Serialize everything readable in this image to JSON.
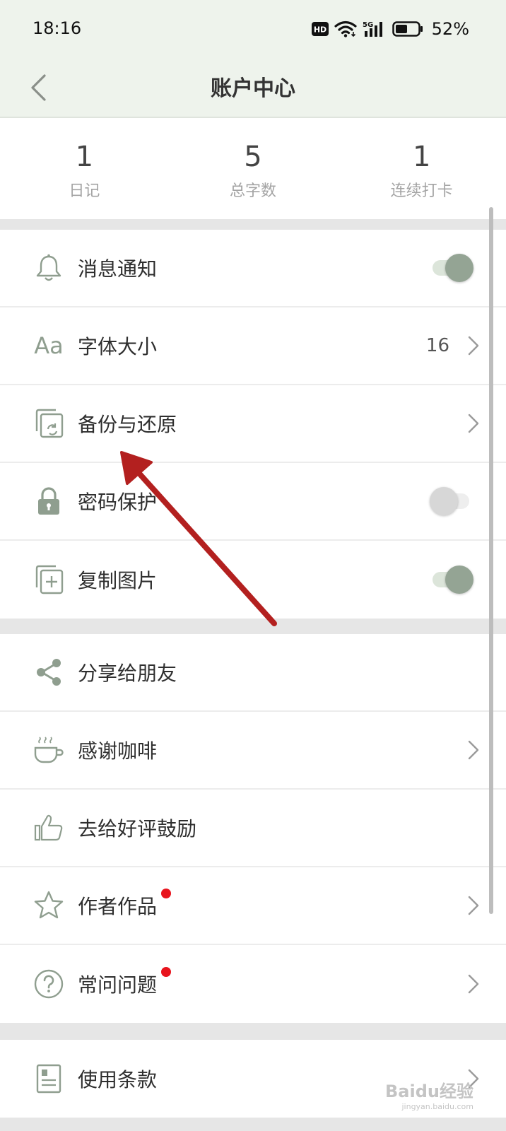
{
  "status_bar": {
    "time": "18:16",
    "hd_label": "HD",
    "network_label": "5G",
    "battery_percent": "52%",
    "battery_level": 0.52
  },
  "nav": {
    "title": "账户中心",
    "back_icon": "chevron-left-icon"
  },
  "stats": [
    {
      "value": "1",
      "label": "日记"
    },
    {
      "value": "5",
      "label": "总字数"
    },
    {
      "value": "1",
      "label": "连续打卡"
    }
  ],
  "settings": {
    "notification": {
      "label": "消息通知",
      "icon": "bell-icon",
      "toggle_on": true
    },
    "font_size": {
      "label": "字体大小",
      "icon": "font-size-icon",
      "icon_text": "Aa",
      "value": "16"
    },
    "backup": {
      "label": "备份与还原",
      "icon": "backup-restore-icon"
    },
    "password": {
      "label": "密码保护",
      "icon": "lock-icon",
      "toggle_on": false
    },
    "copy_image": {
      "label": "复制图片",
      "icon": "copy-add-icon",
      "toggle_on": true
    }
  },
  "social": {
    "share": {
      "label": "分享给朋友",
      "icon": "share-icon"
    },
    "coffee": {
      "label": "感谢咖啡",
      "icon": "coffee-icon"
    },
    "rate": {
      "label": "去给好评鼓励",
      "icon": "thumbs-up-icon"
    },
    "works": {
      "label": "作者作品",
      "icon": "star-icon",
      "has_badge": true
    },
    "faq": {
      "label": "常问问题",
      "icon": "question-icon",
      "has_badge": true
    }
  },
  "legal": {
    "terms": {
      "label": "使用条款",
      "icon": "document-icon"
    }
  },
  "colors": {
    "header_bg": "#eef3ec",
    "icon": "#8f9e8f",
    "toggle_on": "#94a494",
    "badge": "#e8141d",
    "annotation_arrow": "#b3201f"
  },
  "watermark": {
    "text": "Baidu经验",
    "subtext": "jingyan.baidu.com"
  }
}
